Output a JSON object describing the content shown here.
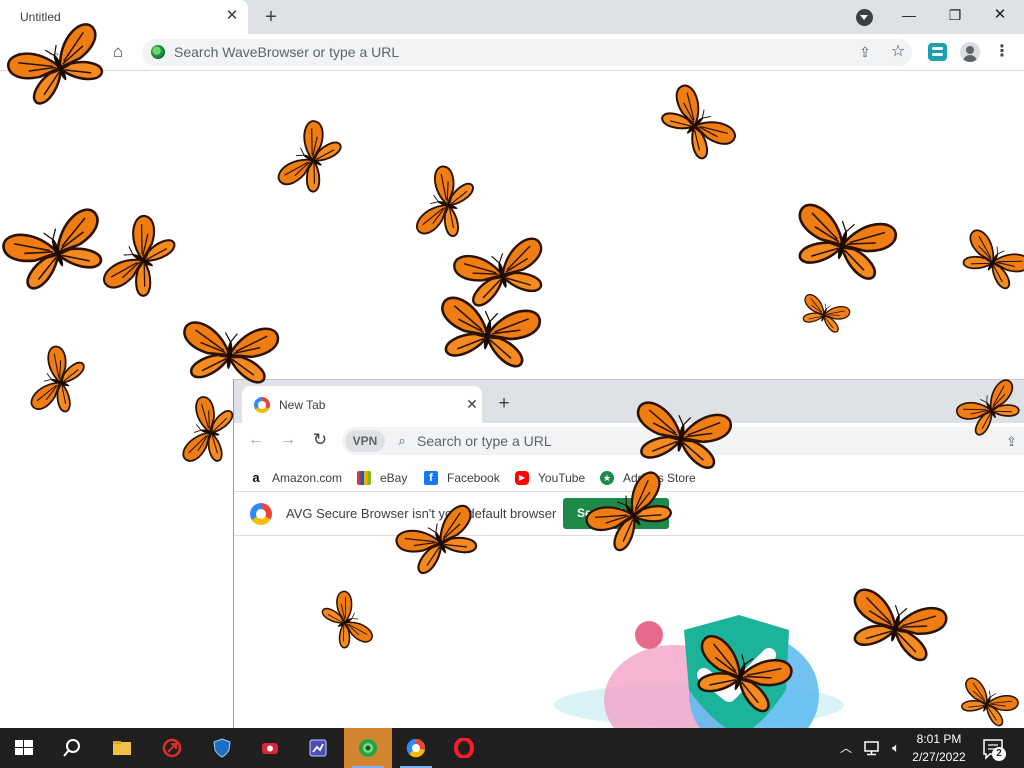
{
  "outer_browser": {
    "tab_title": "Untitled",
    "omnibox_placeholder": "Search WaveBrowser or type a URL",
    "icons": [
      "back-arrow-icon",
      "forward-arrow-icon",
      "home-icon",
      "share-icon",
      "star-icon",
      "extension-icon",
      "profile-icon",
      "kebab-menu-icon",
      "tab-search-icon",
      "close-icon",
      "plus-icon"
    ]
  },
  "avg_browser": {
    "tab_title": "New Tab",
    "vpn_label": "VPN",
    "omnibox_placeholder": "Search or type a URL",
    "bookmarks": [
      {
        "label": "Amazon.com",
        "icon": "amazon-icon"
      },
      {
        "label": "eBay",
        "icon": "ebay-icon"
      },
      {
        "label": "Facebook",
        "icon": "facebook-icon"
      },
      {
        "label": "YouTube",
        "icon": "youtube-icon"
      },
      {
        "label": "Addons Store",
        "icon": "addons-store-icon"
      }
    ],
    "infobar": {
      "message": "AVG Secure Browser isn't your default browser",
      "button": "Set as default"
    },
    "colors": {
      "accent_green": "#1e8a4a"
    }
  },
  "taskbar": {
    "apps": [
      "start-icon",
      "search-icon",
      "file-explorer-icon",
      "app-icon",
      "shield-app-icon",
      "camera-app-icon",
      "chart-app-icon",
      "wavebrowser-icon",
      "avg-browser-icon",
      "opera-icon"
    ],
    "clock": {
      "time": "8:01 PM",
      "date": "2/27/2022"
    },
    "notification_count": "2"
  },
  "overlay": {
    "description_icon": "monarch-butterfly-icon",
    "butterfly_color": "#f07d12"
  }
}
